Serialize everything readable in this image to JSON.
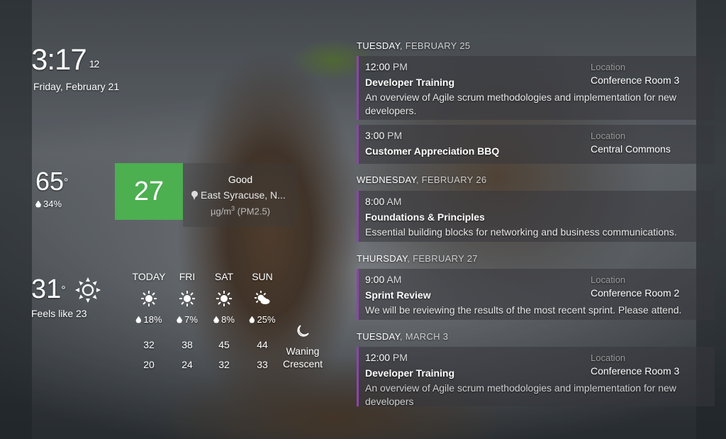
{
  "clock": {
    "time": "3:17",
    "seconds": "12",
    "date": "Friday, February 21"
  },
  "indoor": {
    "temp": "65",
    "humidity": "34%"
  },
  "aqi": {
    "value": "27",
    "status": "Good",
    "location": "East Syracuse, N...",
    "unit_prefix": "µg/m",
    "unit_exp": "3",
    "unit_suffix": " (PM2.5)",
    "color": "#4caf50"
  },
  "current": {
    "temp": "31",
    "feels_like": "Feels like 23",
    "icon": "sun-icon"
  },
  "forecast": [
    {
      "day": "TODAY",
      "pop": "18%",
      "high": "32",
      "low": "20",
      "icon": "sun-icon"
    },
    {
      "day": "FRI",
      "pop": "7%",
      "high": "38",
      "low": "24",
      "icon": "sun-icon"
    },
    {
      "day": "SAT",
      "pop": "8%",
      "high": "45",
      "low": "32",
      "icon": "sun-icon"
    },
    {
      "day": "SUN",
      "pop": "25%",
      "high": "44",
      "low": "33",
      "icon": "partly-cloudy-icon"
    }
  ],
  "moon": {
    "phase_line1": "Waning",
    "phase_line2": "Crescent",
    "icon": "moon-icon"
  },
  "calendar": {
    "accent": "#8e44ad",
    "location_label": "Location",
    "days": [
      {
        "dow": "TUESDAY",
        "md": ", FEBRUARY 25",
        "events": [
          {
            "time": "12:00",
            "ampm": " PM",
            "title": "Developer Training",
            "desc": "An overview of Agile scrum methodologies and implementation for new developers.",
            "location": "Conference Room 3"
          },
          {
            "time": "3:00",
            "ampm": " PM",
            "title": "Customer Appreciation BBQ",
            "desc": "",
            "location": "Central Commons"
          }
        ]
      },
      {
        "dow": "WEDNESDAY",
        "md": ", FEBRUARY 26",
        "events": [
          {
            "time": "8:00",
            "ampm": " AM",
            "title": "Foundations & Principles",
            "desc": "Essential building blocks for networking and business communications.",
            "location": ""
          }
        ]
      },
      {
        "dow": "THURSDAY",
        "md": ", FEBRUARY 27",
        "events": [
          {
            "time": "9:00",
            "ampm": " AM",
            "title": "Sprint Review",
            "desc": "We will be reviewing the results of the most recent sprint. Please attend.",
            "location": "Conference Room 2"
          }
        ]
      },
      {
        "dow": "TUESDAY",
        "md": ", MARCH 3",
        "events": [
          {
            "time": "12:00",
            "ampm": " PM",
            "title": "Developer Training",
            "desc": "An overview of Agile scrum methodologies and implementation for new developers",
            "location": "Conference Room 3"
          }
        ]
      }
    ]
  }
}
